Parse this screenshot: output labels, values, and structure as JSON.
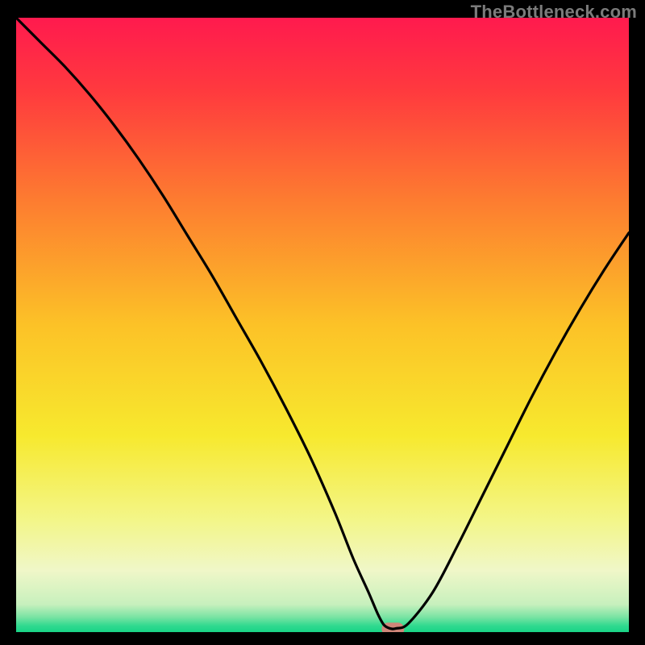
{
  "attribution": "TheBottleneck.com",
  "chart_data": {
    "type": "line",
    "title": "",
    "xlabel": "",
    "ylabel": "",
    "xlim": [
      0,
      100
    ],
    "ylim": [
      0,
      100
    ],
    "background_gradient": {
      "stops": [
        {
          "offset": 0.0,
          "color": "#ff1a4e"
        },
        {
          "offset": 0.12,
          "color": "#ff3a3e"
        },
        {
          "offset": 0.3,
          "color": "#fd7d30"
        },
        {
          "offset": 0.5,
          "color": "#fcc227"
        },
        {
          "offset": 0.68,
          "color": "#f7e92e"
        },
        {
          "offset": 0.82,
          "color": "#f3f68a"
        },
        {
          "offset": 0.9,
          "color": "#f0f7c8"
        },
        {
          "offset": 0.955,
          "color": "#c7f0bd"
        },
        {
          "offset": 0.975,
          "color": "#7ce4a4"
        },
        {
          "offset": 0.99,
          "color": "#2fd98f"
        },
        {
          "offset": 1.0,
          "color": "#19d487"
        }
      ]
    },
    "series": [
      {
        "name": "bottleneck-curve",
        "color": "#000000",
        "width": 3.2,
        "x": [
          0,
          4,
          8,
          12,
          16,
          20,
          24,
          28,
          32,
          36,
          40,
          44,
          48,
          52,
          55,
          57.5,
          59,
          60,
          61,
          62,
          64,
          68,
          72,
          76,
          80,
          84,
          88,
          92,
          96,
          100
        ],
        "y": [
          100,
          96,
          92,
          87.5,
          82.5,
          77,
          71,
          64.5,
          58,
          51,
          44,
          36.5,
          28.5,
          19.5,
          12,
          6.5,
          3,
          1.2,
          0.6,
          0.6,
          1.4,
          6.5,
          14,
          22,
          30,
          38,
          45.5,
          52.5,
          59,
          65
        ]
      }
    ],
    "marker": {
      "name": "optimum-marker",
      "x": 61.5,
      "y": 0.5,
      "color": "#cf8679",
      "rx": 14,
      "ry": 8
    }
  }
}
